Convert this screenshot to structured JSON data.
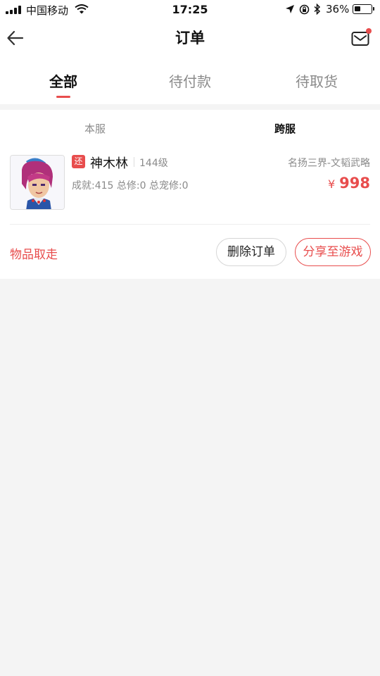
{
  "status_bar": {
    "carrier": "中国移动",
    "time": "17:25",
    "battery": "36%",
    "battery_level": 0.36,
    "icons": [
      "signal-icon",
      "wifi-icon",
      "location-icon",
      "rotation-lock-icon",
      "bluetooth-icon",
      "battery-icon"
    ]
  },
  "nav": {
    "title": "订单",
    "back_icon": "arrow-left-icon",
    "mail_icon": "mail-icon",
    "has_unread": true
  },
  "tabs": [
    {
      "label": "全部",
      "active": true
    },
    {
      "label": "待付款",
      "active": false
    },
    {
      "label": "待取货",
      "active": false
    }
  ],
  "sub_tabs": [
    {
      "label": "本服",
      "active": false
    },
    {
      "label": "跨服",
      "active": true
    }
  ],
  "order": {
    "badge": "还",
    "name": "神木林",
    "level": "144级",
    "server": "名扬三界-文韬武略",
    "stats": "成就:415 总修:0 总宠修:0",
    "currency": "¥",
    "price": "998",
    "status": "物品取走",
    "actions": {
      "delete": "删除订单",
      "share": "分享至游戏"
    }
  },
  "colors": {
    "accent": "#e84d4d",
    "text_primary": "#111111",
    "text_secondary": "#8a8a8a",
    "background": "#f4f4f4"
  }
}
